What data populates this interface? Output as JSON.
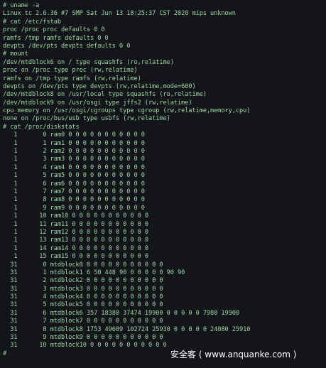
{
  "terminal": {
    "lines": [
      "# uname -a",
      "Linux tc 2.6.36 #7 SMP Sat Jun 13 18:25:37 CST 2020 mips unknown",
      "# cat /etc/fstab",
      "proc /proc proc defaults 0 0",
      "ramfs /tmp ramfs defaults 0 0",
      "devpts /dev/pts devpts defaults 0 0",
      "# mount",
      "/dev/mtdblock6 on / type squashfs (ro,relatime)",
      "proc on /proc type proc (rw,relatime)",
      "ramfs on /tmp type ramfs (rw,relatime)",
      "devpts on /dev/pts type devpts (rw,relatime,mode=600)",
      "/dev/mtdblock8 on /usr/local type squashfs (ro,relatime)",
      "/dev/mtdblock9 on /usr/osgi type jffs2 (rw,relatime)",
      "cpu_memory on /usr/osgi/cgroups type cgroup (rw,relatime,memory,cpu)",
      "none on /proc/bus/usb type usbfs (rw,relatime)",
      "# cat /proc/diskstats",
      "   1       0 ram0 0 0 0 0 0 0 0 0 0 0 0",
      "   1       1 ram1 0 0 0 0 0 0 0 0 0 0 0",
      "   1       2 ram2 0 0 0 0 0 0 0 0 0 0 0",
      "   1       3 ram3 0 0 0 0 0 0 0 0 0 0 0",
      "   1       4 ram4 0 0 0 0 0 0 0 0 0 0 0",
      "   1       5 ram5 0 0 0 0 0 0 0 0 0 0 0",
      "   1       6 ram6 0 0 0 0 0 0 0 0 0 0 0",
      "   1       7 ram7 0 0 0 0 0 0 0 0 0 0 0",
      "   1       8 ram8 0 0 0 0 0 0 0 0 0 0 0",
      "   1       9 ram9 0 0 0 0 0 0 0 0 0 0 0",
      "   1      10 ram10 0 0 0 0 0 0 0 0 0 0 0",
      "   1      11 ram11 0 0 0 0 0 0 0 0 0 0 0",
      "   1      12 ram12 0 0 0 0 0 0 0 0 0 0 0",
      "   1      13 ram13 0 0 0 0 0 0 0 0 0 0 0",
      "   1      14 ram14 0 0 0 0 0 0 0 0 0 0 0",
      "   1      15 ram15 0 0 0 0 0 0 0 0 0 0 0",
      "  31       0 mtdblock0 0 0 0 0 0 0 0 0 0 0 0",
      "  31       1 mtdblock1 6 50 448 90 0 0 0 0 0 90 90",
      "  31       2 mtdblock2 0 0 0 0 0 0 0 0 0 0 0",
      "  31       3 mtdblock3 0 0 0 0 0 0 0 0 0 0 0",
      "  31       4 mtdblock4 0 0 0 0 0 0 0 0 0 0 0",
      "  31       5 mtdblock5 0 0 0 0 0 0 0 0 0 0 0",
      "  31       6 mtdblock6 357 18380 37474 19900 0 0 0 0 0 7980 19900",
      "  31       7 mtdblock7 0 0 0 0 0 0 0 0 0 0 0",
      "  31       8 mtdblock8 1753 49609 102724 25930 0 0 0 0 0 24080 25910",
      "  31       9 mtdblock9 0 0 0 0 0 0 0 0 0 0 0",
      "  31      10 mtdblock10 0 0 0 0 0 0 0 0 0 0 0",
      "#"
    ]
  },
  "watermark": {
    "text": "安全客 ( www.anquanke.com )"
  },
  "colors": {
    "background": "#14151b",
    "text": "#9ad89f",
    "watermark": "#ffffff"
  }
}
